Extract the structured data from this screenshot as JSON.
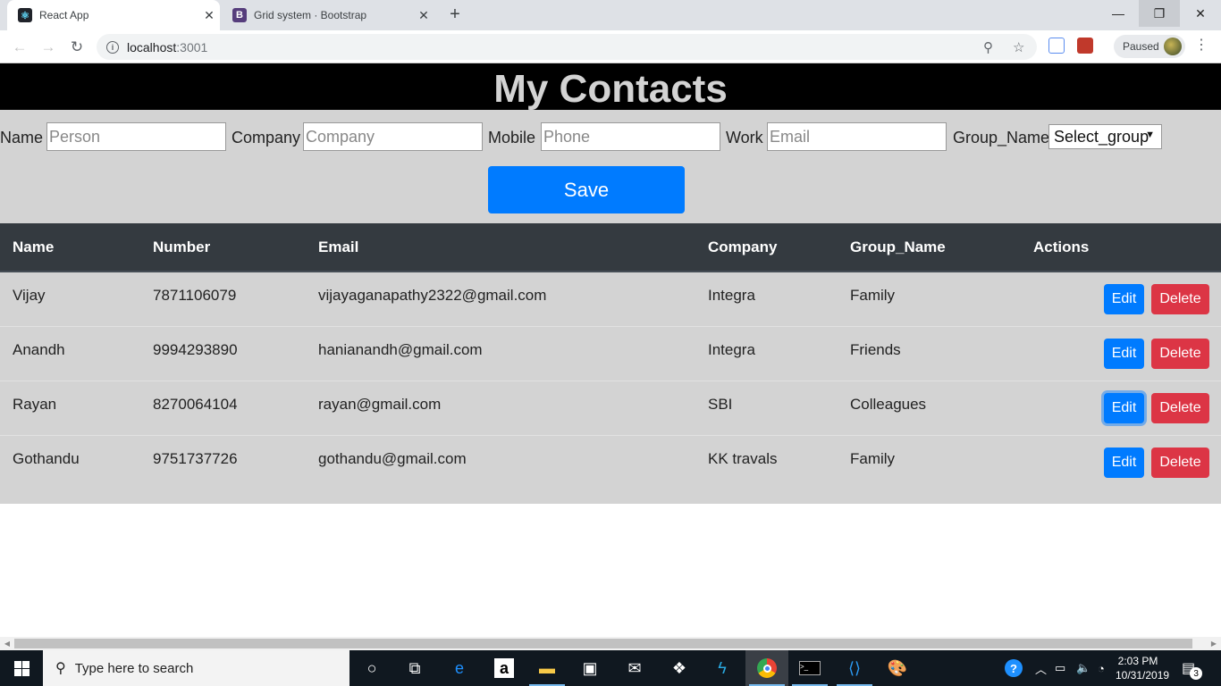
{
  "browser": {
    "tabs": [
      {
        "title": "React App",
        "close": "✕"
      },
      {
        "title": "Grid system · Bootstrap",
        "close": "✕"
      }
    ],
    "url_host": "localhost",
    "url_port": ":3001",
    "paused_label": "Paused"
  },
  "app": {
    "title": "My Contacts",
    "form": {
      "name_label": "Name",
      "name_placeholder": "Person",
      "company_label": "Company",
      "company_placeholder": "Company",
      "mobile_label": "Mobile",
      "mobile_placeholder": "Phone",
      "work_label": "Work",
      "work_placeholder": "Email",
      "group_label": "Group_Name",
      "group_selected": "Select_group",
      "save_label": "Save"
    },
    "table": {
      "headers": [
        "Name",
        "Number",
        "Email",
        "Company",
        "Group_Name",
        "Actions"
      ],
      "edit_label": "Edit",
      "delete_label": "Delete",
      "rows": [
        {
          "name": "Vijay",
          "number": "7871106079",
          "email": "vijayaganapathy2322@gmail.com",
          "company": "Integra",
          "group": "Family"
        },
        {
          "name": "Anandh",
          "number": "9994293890",
          "email": "hanianandh@gmail.com",
          "company": "Integra",
          "group": "Friends"
        },
        {
          "name": "Rayan",
          "number": "8270064104",
          "email": "rayan@gmail.com",
          "company": "SBI",
          "group": "Colleagues"
        },
        {
          "name": "Gothandu",
          "number": "9751737726",
          "email": "gothandu@gmail.com",
          "company": "KK travals",
          "group": "Family"
        }
      ]
    }
  },
  "taskbar": {
    "search_placeholder": "Type here to search",
    "time": "2:03 PM",
    "date": "10/31/2019",
    "notification_count": "3"
  },
  "colors": {
    "primary": "#007bff",
    "danger": "#dc3545",
    "table_header": "#343a40",
    "panel": "#d3d3d3"
  }
}
